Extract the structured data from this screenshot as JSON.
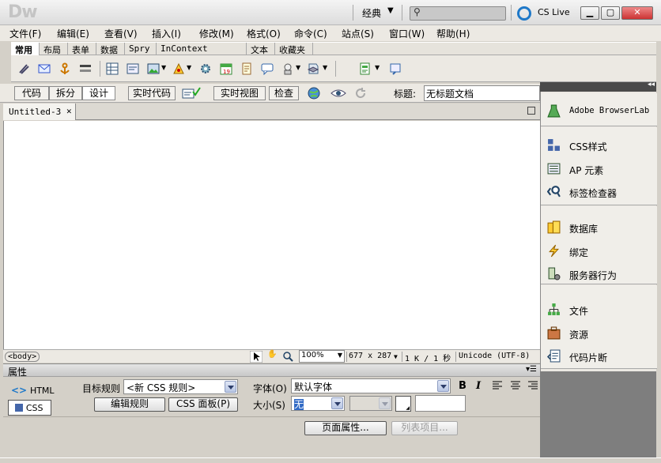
{
  "app": {
    "logo": "Dw",
    "workspace": "经典",
    "search_placeholder": "",
    "cslive": "CS Live"
  },
  "menu": [
    "文件(F)",
    "编辑(E)",
    "查看(V)",
    "插入(I)",
    "修改(M)",
    "格式(O)",
    "命令(C)",
    "站点(S)",
    "窗口(W)",
    "帮助(H)"
  ],
  "insert_tabs": [
    "常用",
    "布局",
    "表单",
    "数据",
    "Spry",
    "InContext Editing",
    "文本",
    "收藏夹"
  ],
  "doc_toolbar": {
    "view_buttons": [
      "代码",
      "拆分",
      "设计"
    ],
    "live_code": "实时代码",
    "live_view": "实时视图",
    "inspect": "检查",
    "title_label": "标题:",
    "title_value": "无标题文档"
  },
  "document_tab": {
    "name": "Untitled-3"
  },
  "status": {
    "tag": "<body>",
    "zoom": "100%",
    "size": "677 x 287",
    "download": "1 K / 1 秒",
    "encoding": "Unicode (UTF-8)"
  },
  "properties": {
    "header": "属性",
    "html_label": "HTML",
    "css_label": "CSS",
    "target_rule_label": "目标规则",
    "target_rule_value": "<新 CSS 规则>",
    "edit_rule": "编辑规则",
    "css_panel": "CSS 面板(P)",
    "font_label": "字体(O)",
    "font_value": "默认字体",
    "size_label": "大小(S)",
    "size_value": "无",
    "page_properties": "页面属性...",
    "list_item": "列表项目..."
  },
  "right_panel": {
    "group1": [
      {
        "label": "Adobe BrowserLab",
        "icon": "browserlab-icon"
      }
    ],
    "group2": [
      {
        "label": "CSS样式",
        "icon": "css-styles-icon"
      },
      {
        "label": "AP 元素",
        "icon": "ap-elements-icon"
      },
      {
        "label": "标签检查器",
        "icon": "tag-inspector-icon"
      }
    ],
    "group3": [
      {
        "label": "数据库",
        "icon": "database-icon"
      },
      {
        "label": "绑定",
        "icon": "bindings-icon"
      },
      {
        "label": "服务器行为",
        "icon": "server-behaviors-icon"
      }
    ],
    "group4": [
      {
        "label": "文件",
        "icon": "files-icon"
      },
      {
        "label": "资源",
        "icon": "assets-icon"
      },
      {
        "label": "代码片断",
        "icon": "snippets-icon"
      }
    ]
  },
  "colors": {
    "accent_blue": "#1e78c8",
    "close_red": "#c33333"
  }
}
